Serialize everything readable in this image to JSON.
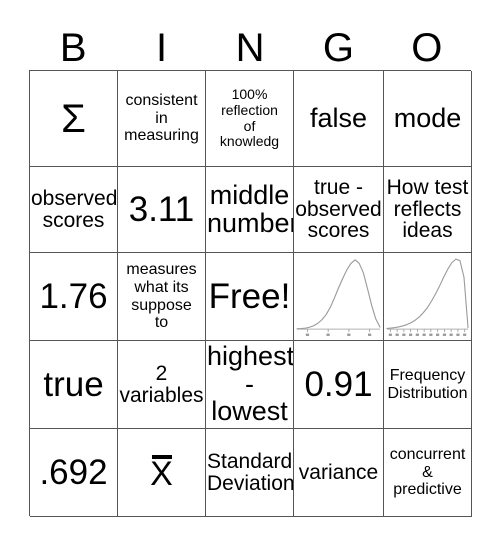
{
  "card": {
    "title": "BINGO",
    "free_space_label": "Free!",
    "header": [
      "B",
      "I",
      "N",
      "G",
      "O"
    ],
    "grid": [
      [
        {
          "text": "Σ",
          "size": "sigma",
          "type": "text"
        },
        {
          "text": "consistent\nin\nmeasuring",
          "size": "sm",
          "type": "text"
        },
        {
          "text": "100%\nreflection\nof\nknowledg",
          "size": "xs",
          "type": "text"
        },
        {
          "text": "false",
          "size": "lg",
          "type": "text"
        },
        {
          "text": "mode",
          "size": "lg",
          "type": "text"
        }
      ],
      [
        {
          "text": "observed\nscores",
          "size": "md",
          "type": "text"
        },
        {
          "text": "3.11",
          "size": "xl",
          "type": "text"
        },
        {
          "text": "middle\nnumber",
          "size": "lg",
          "type": "text"
        },
        {
          "text": "true -\nobserved\nscores",
          "size": "md",
          "type": "text"
        },
        {
          "text": "How test\nreflects\nideas",
          "size": "md",
          "type": "text"
        }
      ],
      [
        {
          "text": "1.76",
          "size": "xl",
          "type": "text"
        },
        {
          "text": "measures\nwhat its\nsuppose\nto",
          "size": "sm",
          "type": "text"
        },
        {
          "text": "Free!",
          "size": "xl",
          "type": "text"
        },
        {
          "text": "",
          "size": "md",
          "type": "chart",
          "chart": "normal-distribution"
        },
        {
          "text": "",
          "size": "md",
          "type": "chart",
          "chart": "negatively-skewed-distribution"
        }
      ],
      [
        {
          "text": "true",
          "size": "xl",
          "type": "text"
        },
        {
          "text": "2\nvariables",
          "size": "md",
          "type": "text"
        },
        {
          "text": "highest\n-\nlowest",
          "size": "lg",
          "type": "text"
        },
        {
          "text": "0.91",
          "size": "xl",
          "type": "text"
        },
        {
          "text": "Frequency\nDistribution",
          "size": "sm",
          "type": "text"
        }
      ],
      [
        {
          "text": ".692",
          "size": "xl",
          "type": "text"
        },
        {
          "text": "X̄",
          "size": "xbar",
          "type": "xbar"
        },
        {
          "text": "Standard\nDeviation",
          "size": "md",
          "type": "text"
        },
        {
          "text": "variance",
          "size": "md",
          "type": "text"
        },
        {
          "text": "concurrent\n&\npredictive",
          "size": "sm",
          "type": "text"
        }
      ]
    ]
  },
  "chart_data": [
    {
      "id": "normal-distribution",
      "type": "line",
      "title": "",
      "xlabel": "",
      "ylabel": "",
      "shape": "symmetric bell curve",
      "tick_count": 4,
      "x": [
        0,
        5,
        10,
        15,
        20,
        25,
        30,
        35,
        40,
        45,
        50,
        55,
        60,
        65,
        70,
        75,
        80,
        85,
        90,
        95,
        100
      ],
      "values": [
        0.5,
        0.8,
        1.4,
        2.6,
        4.7,
        8.0,
        13.0,
        20.0,
        30.0,
        43.0,
        57.0,
        70.0,
        82.0,
        91.0,
        96.0,
        91.0,
        78.0,
        56.0,
        33.0,
        14.0,
        3.0
      ],
      "xlim": [
        0,
        100
      ],
      "ylim": [
        0,
        100
      ],
      "grid": false,
      "legend": "none",
      "line_color": "#9a9a9a"
    },
    {
      "id": "negatively-skewed-distribution",
      "type": "line",
      "title": "",
      "xlabel": "",
      "ylabel": "",
      "shape": "negatively skewed, long left tail, peak near right",
      "tick_count": 12,
      "x": [
        0,
        5,
        10,
        15,
        20,
        25,
        30,
        35,
        40,
        45,
        50,
        55,
        60,
        65,
        70,
        75,
        80,
        85,
        90,
        95,
        100
      ],
      "values": [
        1.0,
        1.5,
        2.2,
        3.2,
        4.6,
        6.5,
        9.0,
        12.5,
        17.0,
        23.0,
        30.0,
        39.0,
        49.0,
        60.0,
        72.0,
        83.0,
        92.0,
        97.0,
        95.0,
        72.0,
        2.0
      ],
      "xlim": [
        0,
        100
      ],
      "ylim": [
        0,
        100
      ],
      "grid": false,
      "legend": "none",
      "line_color": "#9a9a9a"
    }
  ]
}
